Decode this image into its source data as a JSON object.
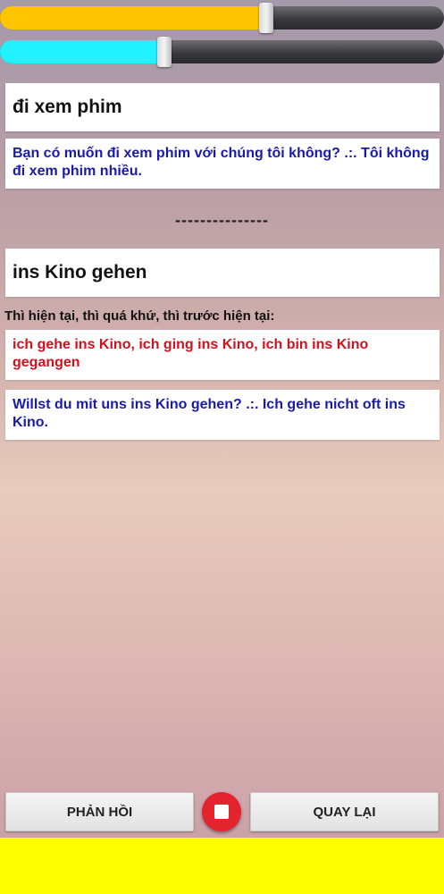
{
  "sliders": [
    {
      "name": "speed",
      "value": 0.6,
      "color": "#ffc400"
    },
    {
      "name": "volume",
      "value": 0.37,
      "color": "#22f2ff"
    }
  ],
  "vietnamese": {
    "word": "đi xem phim",
    "example": "Bạn có muốn đi xem phim với chúng tôi không? .:. Tôi không đi xem phim nhiều."
  },
  "divider": "---------------",
  "german": {
    "word": "ins Kino gehen",
    "tenses_label": "Thì hiện tại, thì quá khứ, thì trước hiện tại:",
    "tenses": "ich gehe ins Kino, ich ging ins Kino, ich bin ins Kino gegangen",
    "example": "Willst du mit uns ins Kino gehen? .:. Ich gehe nicht oft ins Kino."
  },
  "buttons": {
    "feedback": "PHẢN HỒI",
    "back": "QUAY LẠI"
  },
  "colors": {
    "ad_banner": "#ffff00",
    "stop_button": "#e3232e"
  }
}
